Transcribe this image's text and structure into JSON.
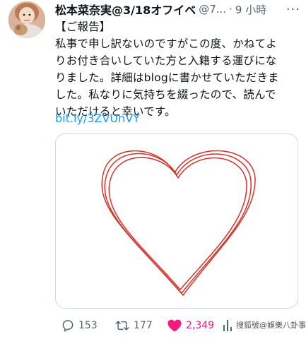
{
  "tweet": {
    "display_name": "松本菜奈実@3/18オフイベ",
    "handle": "@7...",
    "separator": "·",
    "time": "9 小時",
    "more_label": "···",
    "text_lines": [
      "【ご報告】",
      "私事で申し訳ないのですがこの度、かねてよ",
      "りお付き合いしていた方と入籍する運びにな",
      "りました。詳細はblogに書かせていただきま",
      "した。私なりに気持ちを綴ったので、読んで",
      "いただけると幸いです。"
    ],
    "link": "bit.ly/3ZVUnVY",
    "media": {
      "description_icon": "heart-drawing",
      "stroke_color": "#d0342c"
    }
  },
  "actions": {
    "reply_count": "153",
    "retweet_count": "177",
    "like_count": "2,349",
    "views_count": "",
    "like_color": "#f91880"
  },
  "watermark": "搜狐號@娛樂八卦事"
}
